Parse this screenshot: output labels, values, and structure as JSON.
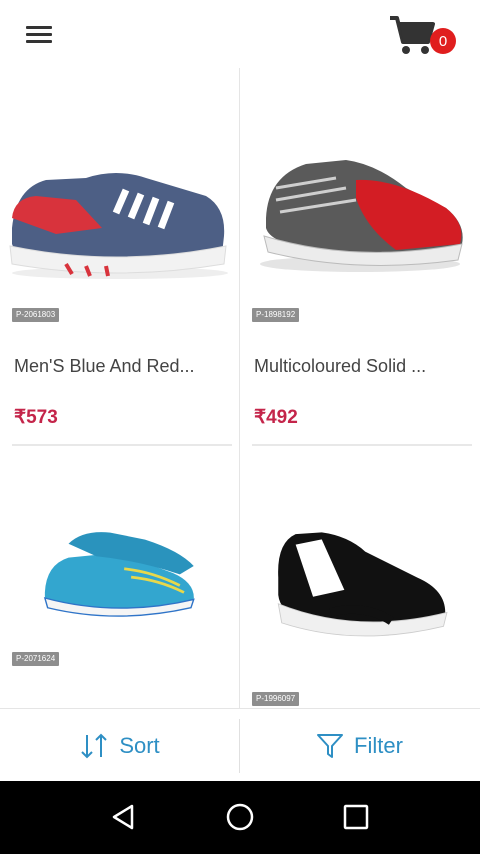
{
  "header": {
    "menu_icon": "hamburger-menu-icon",
    "cart_icon": "shopping-cart-icon",
    "cart_count": "0",
    "colors": {
      "badge": "#e01e1e"
    }
  },
  "products": [
    {
      "id_tag": "P-2061803",
      "name": "Men'S Blue And Red...",
      "price": "₹573"
    },
    {
      "id_tag": "P-1898192",
      "name": "Multicoloured Solid ...",
      "price": "₹492"
    },
    {
      "id_tag": "P-2071624",
      "name": "",
      "price": ""
    },
    {
      "id_tag": "P-1996097",
      "name": "",
      "price": ""
    }
  ],
  "bottom_bar": {
    "sort_label": "Sort",
    "filter_label": "Filter",
    "sort_icon": "sort-arrows-icon",
    "filter_icon": "funnel-icon",
    "colors": {
      "accent": "#2e8fc4"
    }
  },
  "nav": {
    "back_icon": "back-triangle-icon",
    "home_icon": "home-circle-icon",
    "recents_icon": "recents-square-icon"
  },
  "colors": {
    "price": "#c4254a"
  }
}
